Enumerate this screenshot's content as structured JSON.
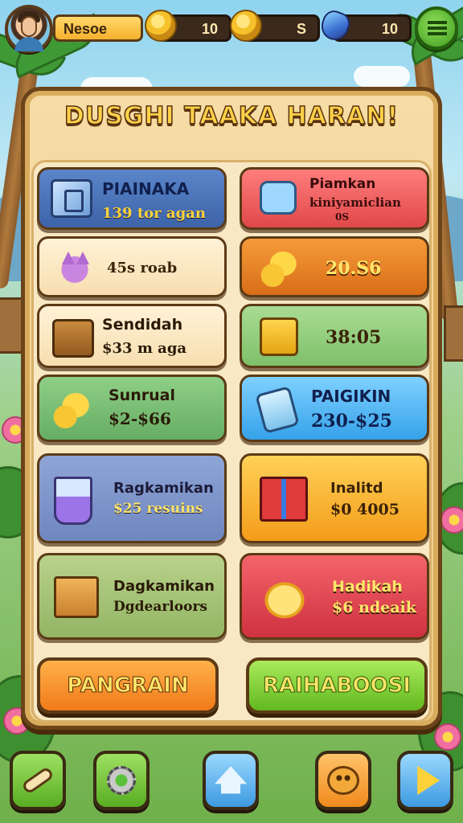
{
  "hud": {
    "player_name": "Nesoe",
    "coins": "10",
    "gold": "S",
    "gems": "10"
  },
  "panel": {
    "title": "DUSGHI TAAKA HARAN!"
  },
  "cards": [
    {
      "line1": "PIAINAKA",
      "line2": "139 tor agan",
      "icon": "safe-icon"
    },
    {
      "line1": "Piamkan",
      "line2": "kiniyamiclian",
      "line3": "0S",
      "icon": "camera-icon"
    },
    {
      "line1": "",
      "line2": "45s roab",
      "icon": "cat-icon"
    },
    {
      "line1": "",
      "line2": "20.S6",
      "icon": "coins-icon"
    },
    {
      "line1": "Sendidah",
      "line2": "$33 m aga",
      "icon": "chest-icon"
    },
    {
      "line1": "",
      "line2": "38:05",
      "icon": "box-icon"
    },
    {
      "line1": "Sunrual",
      "line2": "$2-$66",
      "icon": "coins-icon"
    },
    {
      "line1": "PAIGIKIN",
      "line2": "230-$25",
      "icon": "jar-icon"
    },
    {
      "line1": "Ragkamikan",
      "line2": "$25 resuins",
      "icon": "cup-icon"
    },
    {
      "line1": "Inalitd",
      "line2": "$0 4005",
      "icon": "gift-icon"
    },
    {
      "line1": "Dagkamikan",
      "line2": "Dgdearloors",
      "icon": "crate-icon"
    },
    {
      "line1": "Hadikah",
      "line2": "$6 ndeaik",
      "icon": "gold-icon"
    }
  ],
  "buttons": {
    "left_label": "PANGRAIN",
    "right_label": "RAIHABOOSI"
  },
  "nav": [
    "scroll-icon",
    "gear-icon",
    "home-icon",
    "pet-icon",
    "play-icon"
  ]
}
